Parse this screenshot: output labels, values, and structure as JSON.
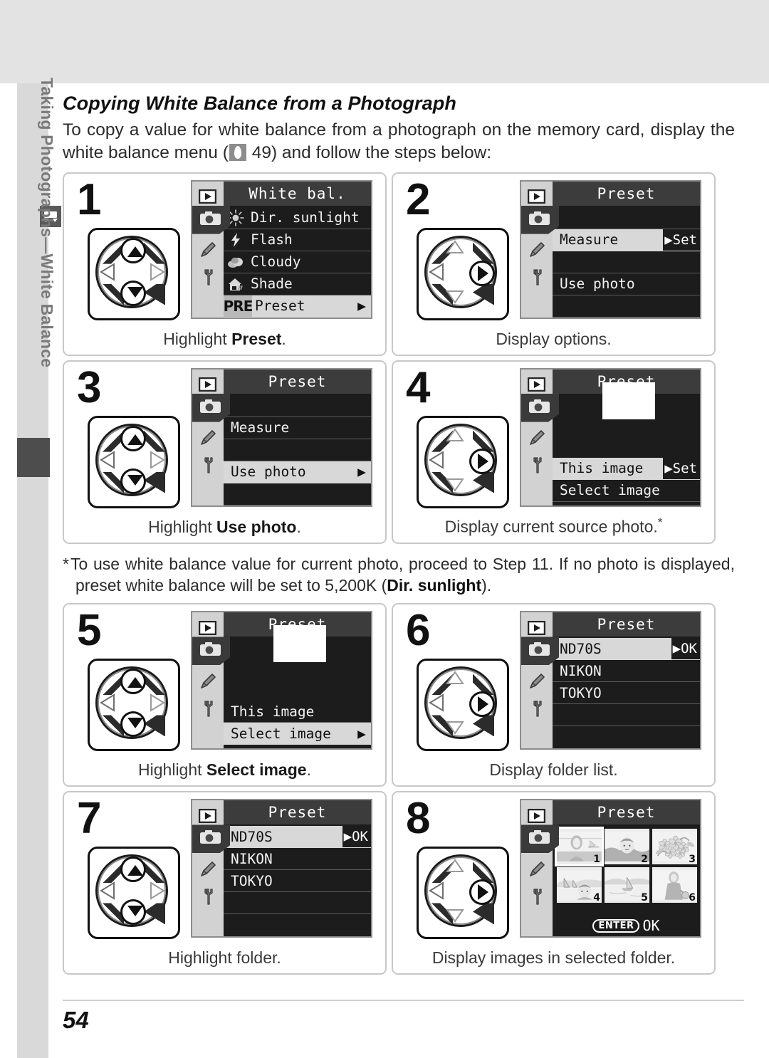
{
  "sidebar": {
    "chapter_label": "Taking Photographs—White Balance",
    "icon": "camera-chapter-icon"
  },
  "header": {
    "section_title": "Copying White Balance from a Photograph",
    "intro_part1": "To copy a value for white balance from a photograph on the memory card, display the white balance menu (",
    "intro_ref_page": "49",
    "intro_part2": ") and follow the steps below:"
  },
  "footnote": {
    "marker": "*",
    "text_a": "To use white balance value for current photo, proceed to Step 11.  If no photo is displayed, preset white balance will be set to 5,200K (",
    "text_bold": "Dir. sunlight",
    "text_b": ")."
  },
  "page": {
    "number": "54"
  },
  "steps": [
    {
      "number": "1",
      "caption_prefix": "Highlight ",
      "caption_bold": "Preset",
      "caption_suffix": ".",
      "dpad": "up-down",
      "menu_title": "White bal.",
      "rows": [
        {
          "label": "Dir. sunlight",
          "icon": "sun-icon",
          "selected": false
        },
        {
          "label": "Flash",
          "icon": "flash-icon",
          "selected": false
        },
        {
          "label": "Cloudy",
          "icon": "cloud-icon",
          "selected": false
        },
        {
          "label": "Shade",
          "icon": "shade-icon",
          "selected": false
        },
        {
          "label": "Preset",
          "tag": "PRE",
          "selected": true,
          "caret": "▶"
        }
      ]
    },
    {
      "number": "2",
      "caption_prefix": "Display options.",
      "caption_bold": "",
      "caption_suffix": "",
      "dpad": "right",
      "menu_title": "Preset",
      "rows": [
        {
          "label": "",
          "blank": true
        },
        {
          "label": "Measure",
          "selected": true,
          "side": "▶Set"
        },
        {
          "label": "",
          "blank": true
        },
        {
          "label": "Use photo",
          "selected": false
        },
        {
          "label": "",
          "blank": true
        }
      ]
    },
    {
      "number": "3",
      "caption_prefix": "Highlight ",
      "caption_bold": "Use photo",
      "caption_suffix": ".",
      "dpad": "up-down",
      "menu_title": "Preset",
      "rows": [
        {
          "label": "",
          "blank": true
        },
        {
          "label": "Measure",
          "selected": false
        },
        {
          "label": "",
          "blank": true
        },
        {
          "label": "Use photo",
          "selected": true,
          "caret": "▶"
        },
        {
          "label": "",
          "blank": true
        }
      ]
    },
    {
      "number": "4",
      "caption_prefix": "Display current source photo.",
      "caption_bold": "",
      "caption_suffix": "*",
      "dpad": "right",
      "menu_title": "Preset",
      "thumbnail_placeholder": true,
      "rows": [
        {
          "label": "This image",
          "selected": true,
          "side": "▶Set"
        },
        {
          "label": "Select image",
          "selected": false
        }
      ]
    },
    {
      "number": "5",
      "caption_prefix": "Highlight ",
      "caption_bold": "Select image",
      "caption_suffix": ".",
      "dpad": "up-down",
      "menu_title": "Preset",
      "thumbnail_placeholder": true,
      "rows": [
        {
          "label": "This image",
          "selected": false
        },
        {
          "label": "Select image",
          "selected": true,
          "caret": "▶"
        }
      ]
    },
    {
      "number": "6",
      "caption_prefix": "Display folder list.",
      "caption_bold": "",
      "caption_suffix": "",
      "dpad": "right",
      "menu_title": "Preset",
      "rows": [
        {
          "label": "ND70S",
          "selected": true,
          "side": "▶OK"
        },
        {
          "label": "NIKON",
          "selected": false
        },
        {
          "label": "TOKYO",
          "selected": false
        },
        {
          "label": "",
          "blank": true
        }
      ]
    },
    {
      "number": "7",
      "caption_prefix": "Highlight folder.",
      "caption_bold": "",
      "caption_suffix": "",
      "dpad": "up-down",
      "menu_title": "Preset",
      "rows": [
        {
          "label": "ND70S",
          "selected": true,
          "side": "▶OK"
        },
        {
          "label": "NIKON",
          "selected": false
        },
        {
          "label": "TOKYO",
          "selected": false
        },
        {
          "label": "",
          "blank": true
        }
      ]
    },
    {
      "number": "8",
      "caption_prefix": "Display images in selected folder.",
      "caption_bold": "",
      "caption_suffix": "",
      "dpad": "right",
      "menu_title": "Preset",
      "thumbnails": [
        {
          "number": "1",
          "art": "woman-portrait",
          "selected": true
        },
        {
          "number": "2",
          "art": "child-portrait",
          "selected": false
        },
        {
          "number": "3",
          "art": "flowers",
          "selected": false
        },
        {
          "number": "4",
          "art": "boy-beach",
          "selected": false
        },
        {
          "number": "5",
          "art": "sailboat-lake",
          "selected": false
        },
        {
          "number": "6",
          "art": "woman-standing",
          "selected": false
        }
      ],
      "footer_button": "ENTER",
      "footer_label": "OK"
    }
  ]
}
